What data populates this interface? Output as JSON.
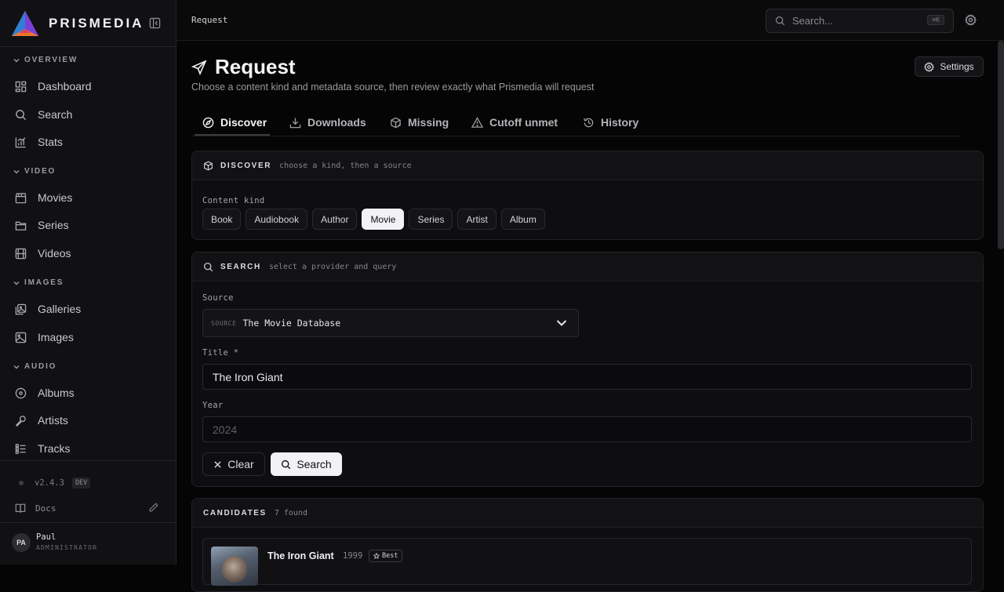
{
  "app": {
    "name": "PRISMEDIA"
  },
  "sidebar": {
    "sections": [
      {
        "label": "OVERVIEW",
        "items": [
          {
            "label": "Dashboard",
            "icon": "dashboard-icon"
          },
          {
            "label": "Search",
            "icon": "search-icon"
          },
          {
            "label": "Stats",
            "icon": "chart-icon"
          }
        ]
      },
      {
        "label": "VIDEO",
        "items": [
          {
            "label": "Movies",
            "icon": "clapperboard-icon"
          },
          {
            "label": "Series",
            "icon": "folder-icon"
          },
          {
            "label": "Videos",
            "icon": "film-icon"
          }
        ]
      },
      {
        "label": "IMAGES",
        "items": [
          {
            "label": "Galleries",
            "icon": "gallery-icon"
          },
          {
            "label": "Images",
            "icon": "image-icon"
          }
        ]
      },
      {
        "label": "AUDIO",
        "items": [
          {
            "label": "Albums",
            "icon": "disc-icon"
          },
          {
            "label": "Artists",
            "icon": "mic-icon"
          },
          {
            "label": "Tracks",
            "icon": "list-music-icon"
          }
        ]
      }
    ],
    "version": "v2.4.3",
    "version_badge": "DEV",
    "docs_label": "Docs",
    "user": {
      "initials": "PA",
      "name": "Paul",
      "role": "ADMINISTRATOR"
    }
  },
  "topbar": {
    "breadcrumb": "Request",
    "search_placeholder": "Search...",
    "search_shortcut": "⌘K"
  },
  "page": {
    "title": "Request",
    "subtitle": "Choose a content kind and metadata source, then review exactly what Prismedia will request",
    "settings_label": "Settings",
    "tabs": [
      {
        "label": "Discover",
        "active": true
      },
      {
        "label": "Downloads",
        "active": false
      },
      {
        "label": "Missing",
        "active": false
      },
      {
        "label": "Cutoff unmet",
        "active": false
      },
      {
        "label": "History",
        "active": false
      }
    ]
  },
  "discover": {
    "heading": "DISCOVER",
    "hint": "choose a kind, then a source",
    "content_kind_label": "Content kind",
    "kinds": [
      "Book",
      "Audiobook",
      "Author",
      "Movie",
      "Series",
      "Artist",
      "Album"
    ],
    "selected_kind": "Movie"
  },
  "search": {
    "heading": "SEARCH",
    "hint": "select a provider and query",
    "source_label": "Source",
    "source_tag": "SOURCE",
    "source_value": "The Movie Database",
    "title_label": "Title *",
    "title_value": "The Iron Giant",
    "year_label": "Year",
    "year_placeholder": "2024",
    "clear_label": "Clear",
    "search_label": "Search"
  },
  "candidates": {
    "heading": "CANDIDATES",
    "count": "7 found",
    "items": [
      {
        "title": "The Iron Giant",
        "year": "1999",
        "badge": "Best"
      }
    ]
  },
  "colors": {
    "accent": "#f2f2f4",
    "background": "#050505",
    "sidebar": "#111113"
  }
}
